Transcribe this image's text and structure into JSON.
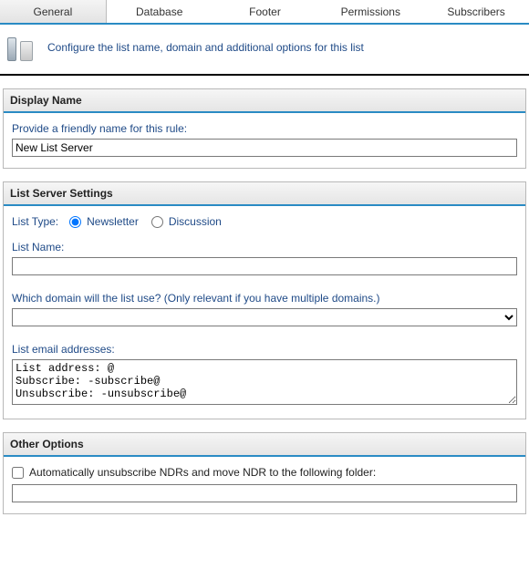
{
  "tabs": {
    "general": "General",
    "database": "Database",
    "footer": "Footer",
    "permissions": "Permissions",
    "subscribers": "Subscribers"
  },
  "header": {
    "description": "Configure the list name, domain and additional options for this list"
  },
  "displayName": {
    "title": "Display Name",
    "label": "Provide a friendly name for this rule:",
    "value": "New List Server"
  },
  "listServerSettings": {
    "title": "List Server Settings",
    "listTypeLabel": "List Type:",
    "newsletterLabel": "Newsletter",
    "discussionLabel": "Discussion",
    "listNameLabel": "List Name:",
    "listNameValue": "",
    "domainLabel": "Which domain will the list use? (Only relevant if you have multiple domains.)",
    "emailAddressesLabel": "List email addresses:",
    "emailAddressesValue": "List address: @\nSubscribe: -subscribe@\nUnsubscribe: -unsubscribe@"
  },
  "otherOptions": {
    "title": "Other Options",
    "autoUnsubLabel": "Automatically unsubscribe NDRs and move NDR to the following folder:",
    "folderValue": ""
  }
}
